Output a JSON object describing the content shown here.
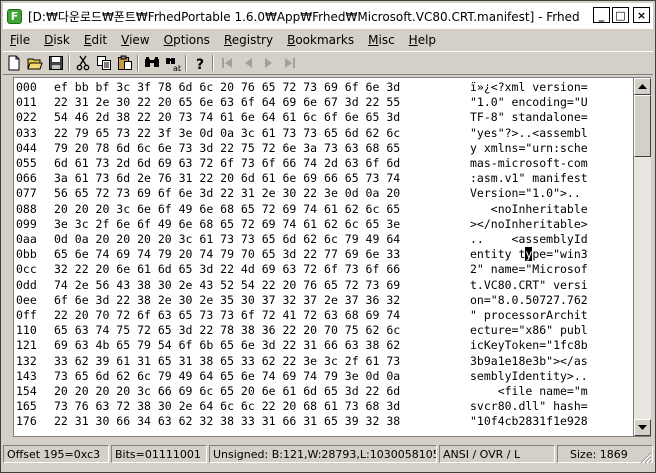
{
  "window": {
    "title": "[D:₩다운로드₩폰트₩FrhedPortable 1.6.0₩App₩Frhed₩Microsoft.VC80.CRT.manifest] - Frhed",
    "app_icon_letter": "F",
    "minimize_glyph": "_",
    "maximize_glyph": "□",
    "close_glyph": "×"
  },
  "menu": [
    {
      "label": "File",
      "u": "F",
      "rest": "ile"
    },
    {
      "label": "Disk",
      "u": "D",
      "rest": "isk"
    },
    {
      "label": "Edit",
      "u": "E",
      "rest": "dit"
    },
    {
      "label": "View",
      "u": "V",
      "rest": "iew"
    },
    {
      "label": "Options",
      "u": "O",
      "rest": "ptions"
    },
    {
      "label": "Registry",
      "u": "R",
      "rest": "egistry"
    },
    {
      "label": "Bookmarks",
      "u": "B",
      "rest": "ookmarks"
    },
    {
      "label": "Misc",
      "u": "M",
      "rest": "isc"
    },
    {
      "label": "Help",
      "u": "H",
      "rest": "elp"
    }
  ],
  "toolbar": {
    "icons": [
      "new-file-icon",
      "open-folder-icon",
      "save-icon",
      "cut-icon",
      "copy-icon",
      "paste-icon",
      "find-icon",
      "replace-icon",
      "help-icon",
      "first-icon",
      "previous-icon",
      "next-icon",
      "last-icon"
    ]
  },
  "hex": {
    "rows": [
      {
        "offset": "000",
        "bytes": "ef bb bf 3c 3f 78 6d 6c 20 76 65 72 73 69 6f 6e 3d",
        "chars": "ï»¿<?xml version="
      },
      {
        "offset": "011",
        "bytes": "22 31 2e 30 22 20 65 6e 63 6f 64 69 6e 67 3d 22 55",
        "chars": "\"1.0\" encoding=\"U"
      },
      {
        "offset": "022",
        "bytes": "54 46 2d 38 22 20 73 74 61 6e 64 61 6c 6f 6e 65 3d",
        "chars": "TF-8\" standalone="
      },
      {
        "offset": "033",
        "bytes": "22 79 65 73 22 3f 3e 0d 0a 3c 61 73 73 65 6d 62 6c",
        "chars": "\"yes\"?>..<assembl"
      },
      {
        "offset": "044",
        "bytes": "79 20 78 6d 6c 6e 73 3d 22 75 72 6e 3a 73 63 68 65",
        "chars": "y xmlns=\"urn:sche"
      },
      {
        "offset": "055",
        "bytes": "6d 61 73 2d 6d 69 63 72 6f 73 6f 66 74 2d 63 6f 6d",
        "chars": "mas-microsoft-com"
      },
      {
        "offset": "066",
        "bytes": "3a 61 73 6d 2e 76 31 22 20 6d 61 6e 69 66 65 73 74",
        "chars": ":asm.v1\" manifest"
      },
      {
        "offset": "077",
        "bytes": "56 65 72 73 69 6f 6e 3d 22 31 2e 30 22 3e 0d 0a 20",
        "chars": "Version=\"1.0\">.. "
      },
      {
        "offset": "088",
        "bytes": "20 20 20 3c 6e 6f 49 6e 68 65 72 69 74 61 62 6c 65",
        "chars": "   <noInheritable"
      },
      {
        "offset": "099",
        "bytes": "3e 3c 2f 6e 6f 49 6e 68 65 72 69 74 61 62 6c 65 3e",
        "chars": "></noInheritable>"
      },
      {
        "offset": "0aa",
        "bytes": "0d 0a 20 20 20 20 3c 61 73 73 65 6d 62 6c 79 49 64",
        "chars": "..    <assemblyId"
      },
      {
        "offset": "0bb",
        "bytes": "65 6e 74 69 74 79 20 74 79 70 65 3d 22 77 69 6e 33",
        "chars_pre": "entity t",
        "chars_caret": "y",
        "chars_post": "pe=\"win3"
      },
      {
        "offset": "0cc",
        "bytes": "32 22 20 6e 61 6d 65 3d 22 4d 69 63 72 6f 73 6f 66",
        "chars": "2\" name=\"Microsof"
      },
      {
        "offset": "0dd",
        "bytes": "74 2e 56 43 38 30 2e 43 52 54 22 20 76 65 72 73 69",
        "chars": "t.VC80.CRT\" versi"
      },
      {
        "offset": "0ee",
        "bytes": "6f 6e 3d 22 38 2e 30 2e 35 30 37 32 37 2e 37 36 32",
        "chars": "on=\"8.0.50727.762"
      },
      {
        "offset": "0ff",
        "bytes": "22 20 70 72 6f 63 65 73 73 6f 72 41 72 63 68 69 74",
        "chars": "\" processorArchit"
      },
      {
        "offset": "110",
        "bytes": "65 63 74 75 72 65 3d 22 78 38 36 22 20 70 75 62 6c",
        "chars": "ecture=\"x86\" publ"
      },
      {
        "offset": "121",
        "bytes": "69 63 4b 65 79 54 6f 6b 65 6e 3d 22 31 66 63 38 62",
        "chars": "icKeyToken=\"1fc8b"
      },
      {
        "offset": "132",
        "bytes": "33 62 39 61 31 65 31 38 65 33 62 22 3e 3c 2f 61 73",
        "chars": "3b9a1e18e3b\"></as"
      },
      {
        "offset": "143",
        "bytes": "73 65 6d 62 6c 79 49 64 65 6e 74 69 74 79 3e 0d 0a",
        "chars": "semblyIdentity>.."
      },
      {
        "offset": "154",
        "bytes": "20 20 20 20 3c 66 69 6c 65 20 6e 61 6d 65 3d 22 6d",
        "chars": "    <file name=\"m"
      },
      {
        "offset": "165",
        "bytes": "73 76 63 72 38 30 2e 64 6c 6c 22 20 68 61 73 68 3d",
        "chars": "svcr80.dll\" hash="
      },
      {
        "offset": "176",
        "bytes": "22 31 30 66 34 63 62 32 38 33 31 66 31 65 39 32 38",
        "chars": "\"10f4cb2831f1e928"
      }
    ]
  },
  "status": {
    "offset": "Offset 195=0xc3",
    "bits": "Bits=01111001",
    "unsigned": "Unsigned: B:121,W:28793,L:1030058105",
    "mode": "ANSI / OVR / L",
    "size": "Size: 1869"
  }
}
